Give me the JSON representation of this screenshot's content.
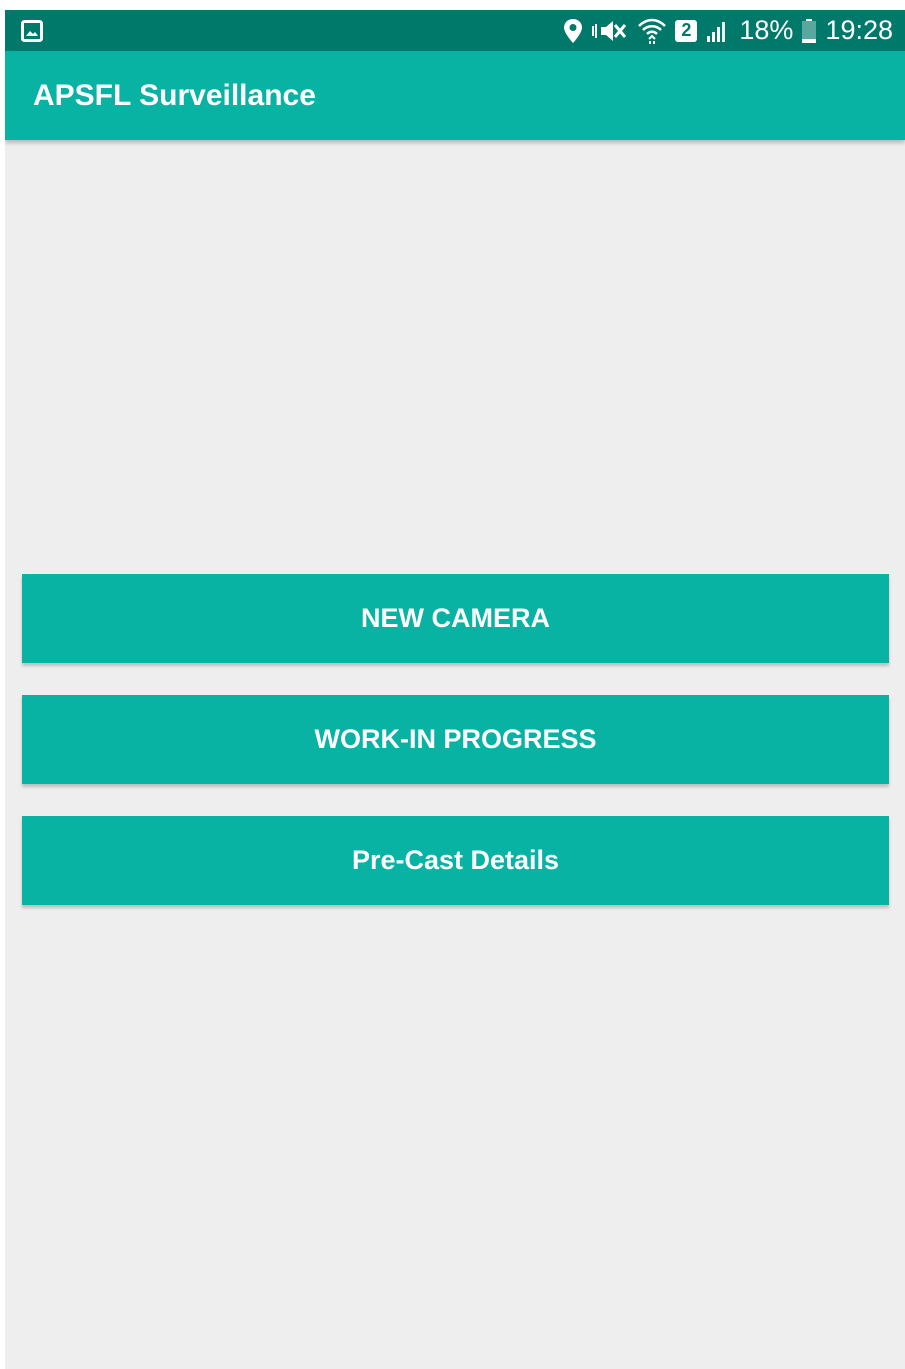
{
  "status_bar": {
    "sim_slot": "2",
    "battery_percent": "18%",
    "time": "19:28",
    "icons": [
      "gallery-icon",
      "location-icon",
      "mute-icon",
      "wifi-icon",
      "sim-icon",
      "signal-icon",
      "battery-icon"
    ]
  },
  "app_bar": {
    "title": "APSFL Surveillance"
  },
  "buttons": [
    {
      "label": "NEW CAMERA"
    },
    {
      "label": "WORK-IN PROGRESS"
    },
    {
      "label": "Pre-Cast Details"
    }
  ],
  "colors": {
    "status_bar": "#00796b",
    "primary": "#08b3a3",
    "background": "#eeeeee",
    "text_on_primary": "#ffffff"
  }
}
